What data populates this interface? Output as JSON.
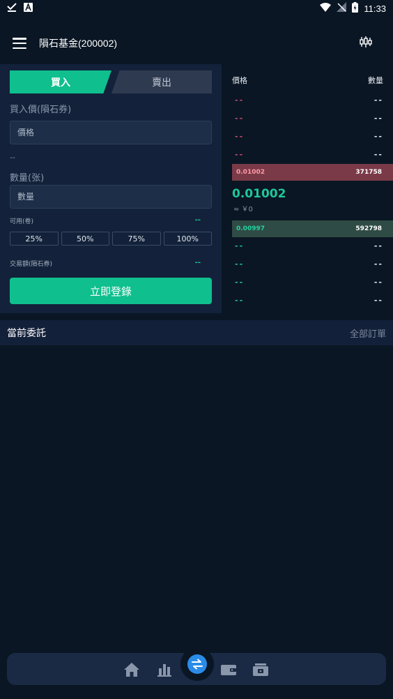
{
  "status_bar": {
    "time": "11:33"
  },
  "header": {
    "title": "隕石基金(200002)"
  },
  "trade": {
    "buy_tab": "買入",
    "sell_tab": "賣出",
    "price_label": "買入價(隕石券)",
    "price_placeholder": "價格",
    "price_dash": "--",
    "amount_label": "數量(张)",
    "amount_placeholder": "數量",
    "available_label": "可用(卷)",
    "available_value": "--",
    "percent_buttons": [
      "25%",
      "50%",
      "75%",
      "100%"
    ],
    "volume_label": "交易額(隕石券)",
    "volume_value": "--",
    "submit": "立即登錄"
  },
  "order_book": {
    "price_header": "價格",
    "qty_header": "數量",
    "asks": [
      {
        "price": "--",
        "qty": "--"
      },
      {
        "price": "--",
        "qty": "--"
      },
      {
        "price": "--",
        "qty": "--"
      },
      {
        "price": "--",
        "qty": "--"
      }
    ],
    "best_ask": {
      "price": "0.01002",
      "qty": "371758"
    },
    "last_price": "0.01002",
    "approx": "≈ ￥0",
    "best_bid": {
      "price": "0.00997",
      "qty": "592798"
    },
    "bids": [
      {
        "price": "--",
        "qty": "--"
      },
      {
        "price": "--",
        "qty": "--"
      },
      {
        "price": "--",
        "qty": "--"
      },
      {
        "price": "--",
        "qty": "--"
      }
    ]
  },
  "orders": {
    "title": "當前委託",
    "all": "全部訂單"
  },
  "bottom_nav": {
    "items": [
      "home-icon",
      "bar-chart-icon",
      "exchange-icon",
      "wallet-icon",
      "purse-icon"
    ],
    "active": "exchange-icon"
  },
  "colors": {
    "accent": "#0fbf8e",
    "ask": "#c94a6c",
    "bid": "#1ec79a",
    "nav_active": "#2a8ce8"
  }
}
